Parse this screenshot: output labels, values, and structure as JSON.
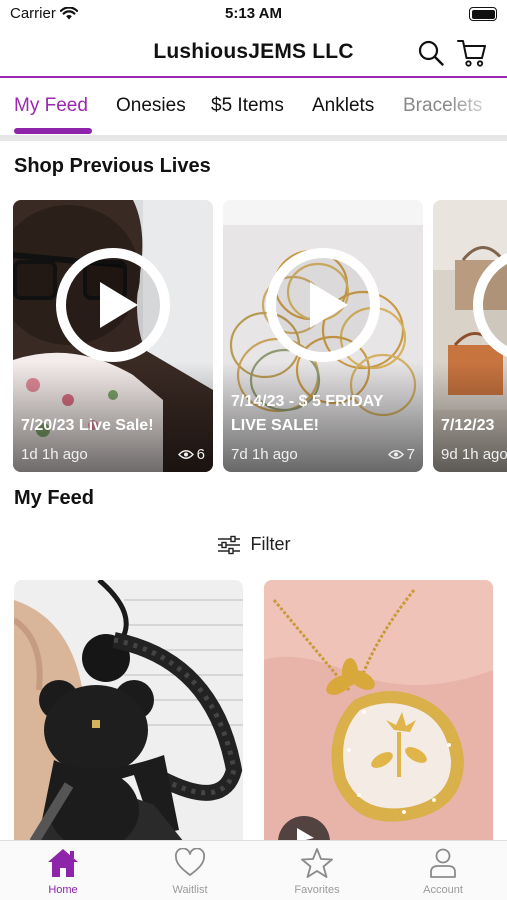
{
  "status_bar": {
    "carrier": "Carrier",
    "time": "5:13 AM"
  },
  "header": {
    "title": "LushiousJEMS LLC",
    "accent_color": "#9c27b0"
  },
  "tabs": [
    {
      "label": "My Feed",
      "active": true
    },
    {
      "label": "Onesies",
      "active": false
    },
    {
      "label": "$5 Items",
      "active": false
    },
    {
      "label": "Anklets",
      "active": false
    },
    {
      "label": "Bracelets",
      "active": false
    }
  ],
  "previous_lives": {
    "title": "Shop Previous Lives",
    "items": [
      {
        "caption": "7/20/23 Live Sale!",
        "age": "1d 1h ago",
        "views": "6"
      },
      {
        "caption": "7/14/23 - $ 5 FRIDAY LIVE SALE!",
        "age": "7d 1h ago",
        "views": "7"
      },
      {
        "caption": "7/12/23",
        "age": "9d 1h ago",
        "views": ""
      }
    ]
  },
  "feed": {
    "title": "My Feed",
    "filter_label": "Filter",
    "products": [
      {
        "icon": "bear-keychain-photo"
      },
      {
        "icon": "lotus-pendant-necklace-photo"
      }
    ]
  },
  "bottom_nav": [
    {
      "label": "Home",
      "icon": "home-icon",
      "active": true
    },
    {
      "label": "Waitlist",
      "icon": "heart-icon",
      "active": false
    },
    {
      "label": "Favorites",
      "icon": "star-icon",
      "active": false
    },
    {
      "label": "Account",
      "icon": "person-icon",
      "active": false
    }
  ]
}
